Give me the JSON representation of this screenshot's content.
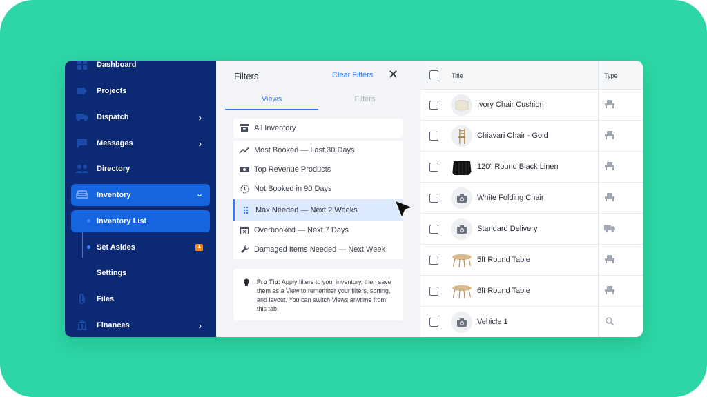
{
  "sidebar": {
    "items": [
      {
        "label": "Dashboard",
        "icon": "dashboard-icon"
      },
      {
        "label": "Projects",
        "icon": "projects-icon"
      },
      {
        "label": "Dispatch",
        "icon": "truck-icon"
      },
      {
        "label": "Messages",
        "icon": "chat-icon"
      },
      {
        "label": "Directory",
        "icon": "people-icon"
      },
      {
        "label": "Inventory",
        "icon": "sofa-icon"
      },
      {
        "label": "Inventory List"
      },
      {
        "label": "Set Asides",
        "badge": "1"
      },
      {
        "label": "Settings"
      },
      {
        "label": "Files",
        "icon": "paperclip-icon"
      },
      {
        "label": "Finances",
        "icon": "bank-icon"
      }
    ]
  },
  "filters": {
    "title": "Filters",
    "clear_label": "Clear Filters",
    "tabs": [
      "Views",
      "Filters"
    ],
    "views": [
      "All Inventory",
      "Most Booked — Last 30 Days",
      "Top Revenue Products",
      "Not Booked in 90 Days",
      "Max Needed — Next 2 Weeks",
      "Overbooked — Next 7 Days",
      "Damaged Items Needed — Next Week"
    ],
    "selected_view": "Max Needed — Next 2 Weeks",
    "tip_label": "Pro Tip:",
    "tip_text": "Apply filters to your inventory, then save them as a View to remember your filters, sorting, and layout. You can switch Views anytime from this tab."
  },
  "table": {
    "columns": [
      "Title",
      "Type"
    ],
    "rows": [
      {
        "title": "Ivory Chair Cushion",
        "type_icon": "chair-icon"
      },
      {
        "title": "Chiavari Chair - Gold",
        "type_icon": "chair-icon"
      },
      {
        "title": "120\" Round Black Linen",
        "type_icon": "chair-icon"
      },
      {
        "title": "White Folding Chair",
        "type_icon": "chair-icon"
      },
      {
        "title": "Standard Delivery",
        "type_icon": "truck-icon"
      },
      {
        "title": "5ft Round Table",
        "type_icon": "chair-icon"
      },
      {
        "title": "6ft Round Table",
        "type_icon": "chair-icon"
      },
      {
        "title": "Vehicle 1",
        "type_icon": "search-icon"
      }
    ]
  },
  "colors": {
    "background": "#2dd6a4",
    "sidebar": "#0c2a73",
    "accent": "#2f7bff",
    "badge": "#f78a14"
  }
}
